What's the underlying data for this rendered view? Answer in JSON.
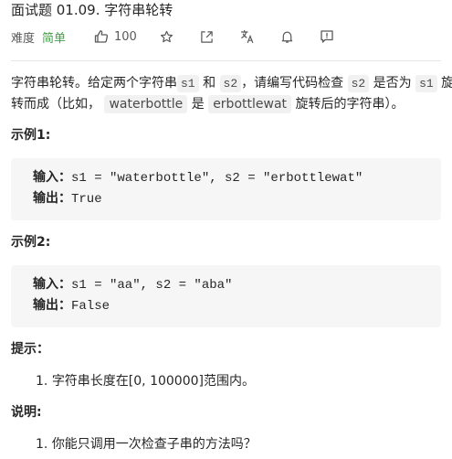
{
  "header": {
    "title": "面试题 01.09. 字符串轮转"
  },
  "meta": {
    "difficulty_label": "难度",
    "difficulty_value": "简单",
    "likes": "100"
  },
  "description": {
    "p1_a": "字符串轮转。给定两个字符串",
    "s1": "s1",
    "and": "和",
    "s2": "s2",
    "p1_b": "，请编写代码检查",
    "p1_c": "是否为",
    "p1_d": "旋",
    "p2_a": "转而成（比如，",
    "ex_a": "waterbottle",
    "is": "是",
    "ex_b": "erbottlewat",
    "p2_b": "旋转后的字符串）。"
  },
  "example1": {
    "heading": "示例1:",
    "input_label": "输入",
    "input_value": "s1 = \"waterbottle\", s2 = \"erbottlewat\"",
    "output_label": "输出",
    "output_value": "True"
  },
  "example2": {
    "heading": "示例2:",
    "input_label": "输入",
    "input_value": "s1 = \"aa\", s2 = \"aba\"",
    "output_label": "输出",
    "output_value": "False"
  },
  "hints": {
    "heading": "提示：",
    "items": [
      "字符串长度在[0, 100000]范围内。"
    ]
  },
  "notes": {
    "heading": "说明:",
    "items": [
      "你能只调用一次检查子串的方法吗？"
    ]
  }
}
